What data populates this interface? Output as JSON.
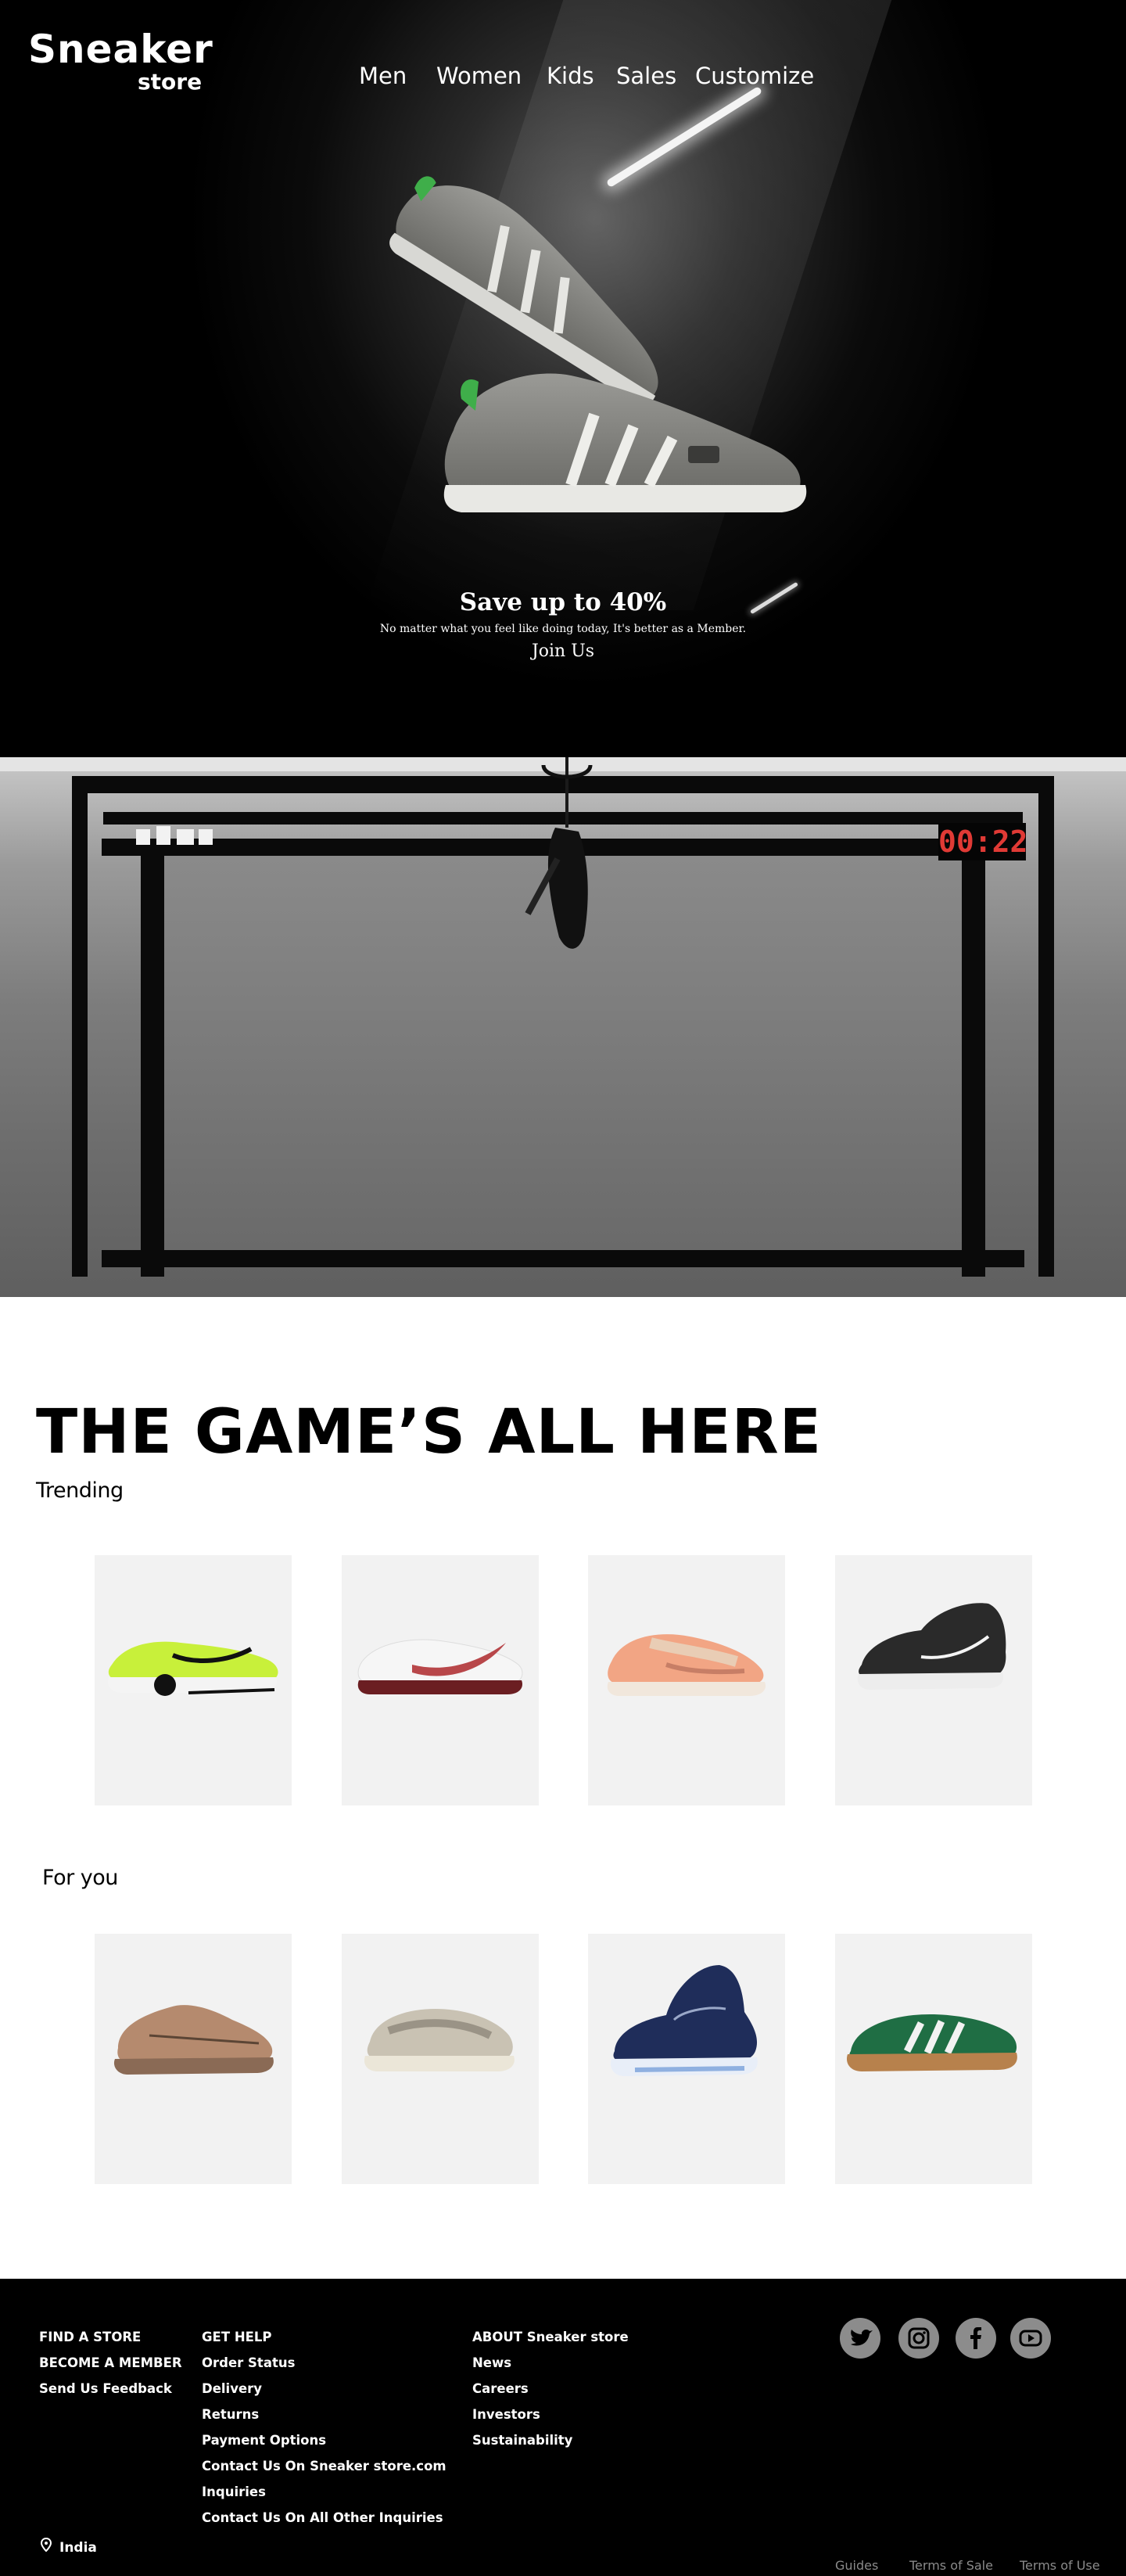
{
  "header": {
    "logo_primary": "Sneaker",
    "logo_secondary": "store",
    "nav": [
      "Men",
      "Women",
      "Kids",
      "Sales",
      "Customize"
    ]
  },
  "hero": {
    "title": "Save up to 40%",
    "subtitle": "No matter what you feel like doing today, It's better as a Member.",
    "cta": "Join Us"
  },
  "video": {
    "timer": "00:22",
    "accent": "#e03a35"
  },
  "main": {
    "headline": "THE GAME’S ALL HERE",
    "trending_label": "Trending",
    "for_you_label": "For you",
    "trending": [
      {
        "icon": "neon-green-sneaker-icon",
        "color": "#c8f03a"
      },
      {
        "icon": "white-red-sneaker-icon",
        "color": "#b8474a"
      },
      {
        "icon": "peach-sneaker-icon",
        "color": "#f2a584"
      },
      {
        "icon": "black-basketball-sneaker-icon",
        "color": "#2a2a2a"
      }
    ],
    "for_you": [
      {
        "icon": "tan-knit-sneaker-icon",
        "color": "#b58a6e"
      },
      {
        "icon": "grey-runner-sneaker-icon",
        "color": "#c9c2b3"
      },
      {
        "icon": "navy-high-top-sneaker-icon",
        "color": "#1f2d5a"
      },
      {
        "icon": "green-suede-sneaker-icon",
        "color": "#1f6e44"
      }
    ]
  },
  "footer": {
    "col1": [
      "FIND A STORE",
      "BECOME A MEMBER",
      "Send Us Feedback"
    ],
    "col2": [
      "GET HELP",
      "Order Status",
      "Delivery",
      "Returns",
      "Payment Options",
      "Contact Us On Sneaker store.com",
      "Inquiries",
      "Contact Us On All Other Inquiries"
    ],
    "col3": [
      "ABOUT Sneaker store",
      "News",
      "Careers",
      "Investors",
      "Sustainability"
    ],
    "social": [
      "twitter-icon",
      "instagram-icon",
      "facebook-icon",
      "youtube-icon"
    ],
    "location": "India",
    "legal": [
      "Guides",
      "Terms of Sale",
      "Terms of Use"
    ]
  }
}
